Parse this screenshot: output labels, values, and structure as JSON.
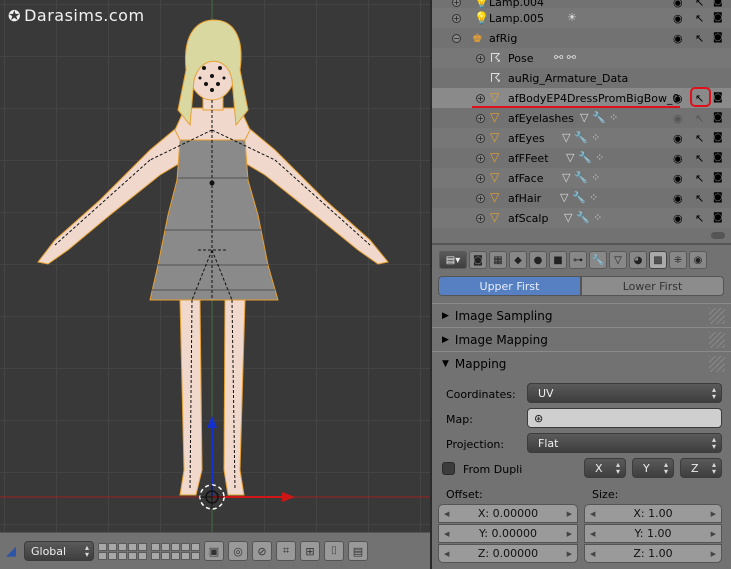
{
  "watermark": "Darasims.com",
  "outliner": {
    "rows": [
      {
        "label": "Lamp.004",
        "icon": "lamp-icon"
      },
      {
        "label": "Lamp.005",
        "icon": "lamp-icon"
      },
      {
        "label": "afRig",
        "icon": "armature-icon"
      },
      {
        "label": "Pose",
        "icon": "pose-icon"
      },
      {
        "label": "auRig_Armature_Data",
        "icon": "armature-data-icon"
      },
      {
        "label": "afBodyEP4DressPromBigBow_0",
        "icon": "mesh-icon"
      },
      {
        "label": "afEyelashes",
        "icon": "mesh-icon"
      },
      {
        "label": "afEyes",
        "icon": "mesh-icon"
      },
      {
        "label": "afFFeet",
        "icon": "mesh-icon"
      },
      {
        "label": "afFace",
        "icon": "mesh-icon"
      },
      {
        "label": "afHair",
        "icon": "mesh-icon"
      },
      {
        "label": "afScalp",
        "icon": "mesh-icon"
      }
    ]
  },
  "viewport_header": {
    "orientation": "Global"
  },
  "properties": {
    "sort_options": {
      "active": "Upper First",
      "inactive": "Lower First"
    },
    "panels": {
      "image_sampling": "Image Sampling",
      "image_mapping": "Image Mapping",
      "mapping": "Mapping"
    },
    "mapping": {
      "coordinates_label": "Coordinates:",
      "coordinates_value": "UV",
      "map_label": "Map:",
      "map_value": "",
      "projection_label": "Projection:",
      "projection_value": "Flat",
      "from_dupli_label": "From Dupli",
      "axis_x": "X",
      "axis_y": "Y",
      "axis_z": "Z"
    },
    "offset": {
      "label": "Offset:",
      "x": "X: 0.00000",
      "y": "Y: 0.00000",
      "z": "Z: 0.00000"
    },
    "size": {
      "label": "Size:",
      "x": "X: 1.00",
      "y": "Y: 1.00",
      "z": "Z: 1.00"
    }
  },
  "colors": {
    "accent": "#5680c2",
    "highlight": "#e0101b",
    "panel_bg": "#727272",
    "viewport_bg": "#393939",
    "selection_outline": "#e8a030"
  }
}
